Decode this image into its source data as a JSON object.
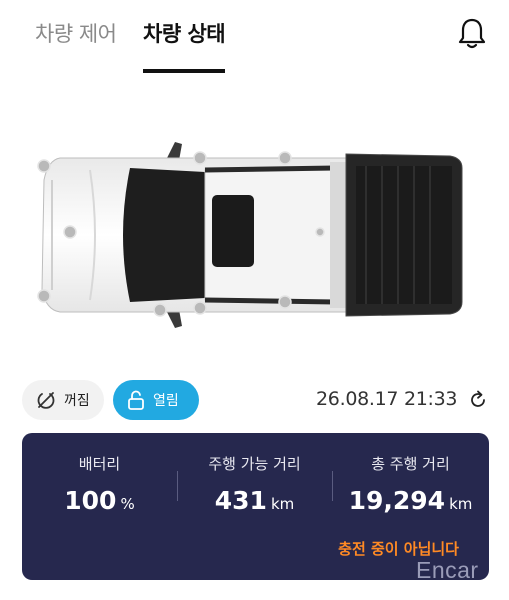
{
  "tabs": [
    {
      "label": "차량 제어",
      "active": false
    },
    {
      "label": "차량 상태",
      "active": true
    }
  ],
  "header": {
    "bell_icon": "bell-icon"
  },
  "car": {
    "view": "top-down pickup truck"
  },
  "controls": {
    "power_chip": {
      "label": "꺼짐",
      "icon": "power-off-icon"
    },
    "lock_chip": {
      "label": "열림",
      "icon": "unlock-icon",
      "color": "#22a9e1"
    }
  },
  "timestamp": "26.08.17 21:33",
  "stats": {
    "battery": {
      "label": "배터리",
      "value": "100",
      "unit": "%"
    },
    "range": {
      "label": "주행 가능 거리",
      "value": "431",
      "unit": "km"
    },
    "odometer": {
      "label": "총 주행 거리",
      "value": "19,294",
      "unit": "km"
    }
  },
  "charge_status": "충전 중이 아닙니다",
  "watermark": "Encar",
  "colors": {
    "panel": "#26284e",
    "accent_orange": "#ff8a24"
  }
}
